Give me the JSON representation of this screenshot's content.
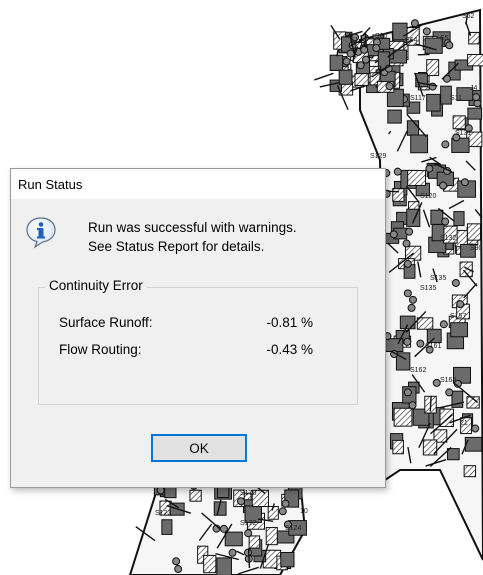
{
  "dialog": {
    "title": "Run Status",
    "message_line1": "Run was successful with warnings.",
    "message_line2": "See Status Report for details.",
    "icon": "info-icon",
    "continuity": {
      "legend": "Continuity Error",
      "rows": [
        {
          "label": "Surface Runoff:",
          "value": "-0.81 %"
        },
        {
          "label": "Flow Routing:",
          "value": "-0.43 %"
        }
      ]
    },
    "ok_label": "OK"
  },
  "map": {
    "labels": [
      "S62",
      "S1",
      "S60",
      "S64",
      "S5",
      "J4",
      "S117",
      "S11",
      "S129",
      "S120",
      "S132",
      "S135",
      "S161",
      "S162",
      "S164",
      "S157",
      "S170",
      "S123",
      "S172",
      "S124",
      "21",
      "10",
      "S90",
      "S131",
      "S135"
    ]
  },
  "colors": {
    "accent": "#0078d7",
    "dialog_bg": "#f0f0f0",
    "info_blue": "#1f5fbf"
  }
}
